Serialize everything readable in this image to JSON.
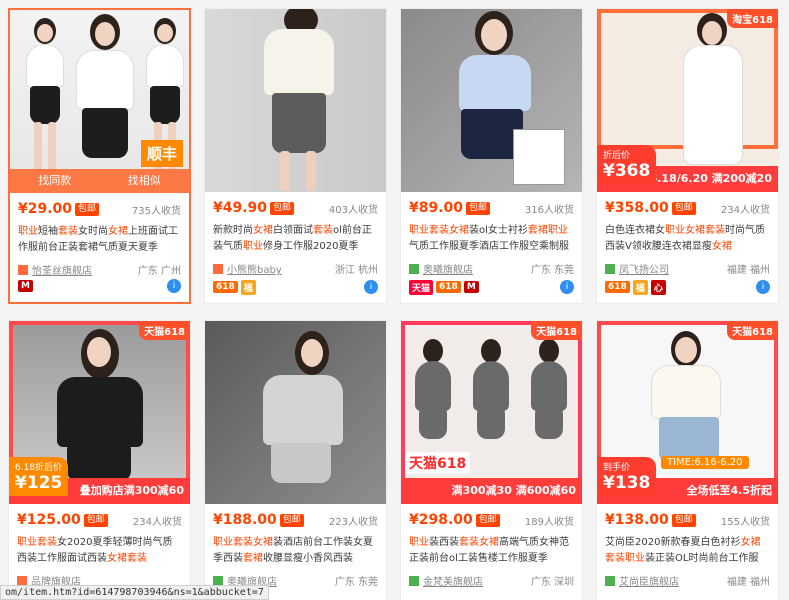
{
  "products": [
    {
      "price": "¥29.00",
      "free_label": "包邮",
      "sales": "735人收货",
      "title_parts": [
        [
          "职业",
          true
        ],
        [
          "短袖",
          false
        ],
        [
          "套装",
          true
        ],
        [
          "女时尚",
          false
        ],
        [
          "女裙",
          true
        ],
        [
          "上班面试工作服前台正装套裙气质夏天夏季",
          false
        ]
      ],
      "shop": "怡荃丝旗舰店",
      "location": "广东 广州",
      "image_tag": "顺丰",
      "hover_left": "找同款",
      "hover_right": "找相似",
      "icons": [
        {
          "name": "red",
          "text": "M"
        }
      ]
    },
    {
      "price": "¥49.90",
      "free_label": "包邮",
      "sales": "403人收货",
      "title_parts": [
        [
          "新款时尚",
          false
        ],
        [
          "女裙",
          true
        ],
        [
          "白领面试",
          false
        ],
        [
          "套装",
          true
        ],
        [
          "ol前台正装气质",
          false
        ],
        [
          "职业",
          true
        ],
        [
          "修身工作服2020夏季",
          false
        ]
      ],
      "shop": "小熊熊baby",
      "location": "浙江 杭州",
      "icons": [
        {
          "name": "s618",
          "text": "618"
        },
        {
          "name": "gold",
          "text": "福"
        }
      ]
    },
    {
      "price": "¥89.00",
      "free_label": "包邮",
      "sales": "316人收货",
      "title_parts": [
        [
          "职业套装女裙",
          true
        ],
        [
          "装ol女士衬衫",
          false
        ],
        [
          "套裙职业",
          true
        ],
        [
          "气质工作服夏季酒店工作服空乘制服女",
          false
        ]
      ],
      "shop": "奥曦旗舰店",
      "location": "广东 东莞",
      "icons": [
        {
          "name": "tmall",
          "text": "天猫"
        },
        {
          "name": "s618",
          "text": "618"
        },
        {
          "name": "red",
          "text": "M"
        }
      ]
    },
    {
      "price": "¥358.00",
      "free_label": "包邮",
      "sales": "234人收货",
      "title_parts": [
        [
          "白色连衣裙女",
          false
        ],
        [
          "职业女裙套装",
          true
        ],
        [
          "时尚气质西装V领收腰连衣裙显瘦",
          false
        ],
        [
          "女裙",
          true
        ]
      ],
      "shop": "凤飞扬公司",
      "location": "福建 福州",
      "badge": "淘宝618",
      "promo_text": "6.18/6.20 满200减20",
      "box_small": "折后价",
      "box_big": "¥368",
      "icons": [
        {
          "name": "s618",
          "text": "618"
        },
        {
          "name": "gold",
          "text": "福"
        },
        {
          "name": "red",
          "text": "心"
        }
      ]
    },
    {
      "price": "¥125.00",
      "free_label": "包邮",
      "sales": "234人收货",
      "title_parts": [
        [
          "职业套装",
          true
        ],
        [
          "女2020夏季轻薄时尚气质西装工作服面试西装",
          false
        ],
        [
          "女裙套装",
          true
        ]
      ],
      "shop": "品牌旗舰店",
      "location": "",
      "badge": "天猫618",
      "promo_text": "叠加购店满300减60",
      "box_small": "6.18折后价",
      "box_big": "¥125",
      "icons": []
    },
    {
      "price": "¥188.00",
      "free_label": "包邮",
      "sales": "223人收货",
      "title_parts": [
        [
          "职业套装女裙",
          true
        ],
        [
          "装酒店前台工作装女夏季西装",
          false
        ],
        [
          "套裙",
          true
        ],
        [
          "收腰显瘦小香风西装",
          false
        ]
      ],
      "shop": "奥曦旗舰店",
      "location": "广东 东莞",
      "icons": []
    },
    {
      "price": "¥298.00",
      "free_label": "包邮",
      "sales": "189人收货",
      "title_parts": [
        [
          "职业",
          true
        ],
        [
          "装西装",
          false
        ],
        [
          "套装女裙",
          true
        ],
        [
          "高端气质女神范正装前台ol工装售楼工作服夏季",
          false
        ]
      ],
      "shop": "金梵美旗舰店",
      "location": "广东 深圳",
      "badge": "天猫618",
      "promo_text": "满300减30  满600减60",
      "brand": "天猫618",
      "icons": []
    },
    {
      "price": "¥138.00",
      "free_label": "包邮",
      "sales": "155人收货",
      "title_parts": [
        [
          "艾尚臣2020新款春夏白色衬衫",
          false
        ],
        [
          "女裙套装",
          true
        ],
        [
          "职业",
          true
        ],
        [
          "装正装OL时尚前台工作服",
          false
        ]
      ],
      "shop": "艾尚臣旗舰店",
      "location": "福建 福州",
      "badge": "天猫618",
      "time_tag": "TIME:6.16-6.20",
      "promo_text": "全场低至4.5折起",
      "box_small": "到手价",
      "box_big": "¥138",
      "icons": []
    }
  ],
  "status_url": "om/item.htm?id=614798703946&ns=1&abbucket=7",
  "colors": {
    "accent": "#ff4400",
    "tmall": "#ff0036",
    "orange": "#ff8a00"
  }
}
